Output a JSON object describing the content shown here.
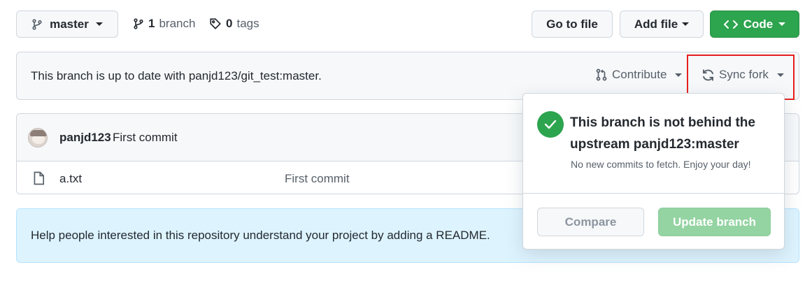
{
  "toolbar": {
    "branch_button_label": "master",
    "branch_count": "1",
    "branch_word": "branch",
    "tag_count": "0",
    "tag_word": "tags",
    "go_to_file_label": "Go to file",
    "add_file_label": "Add file",
    "code_label": "Code"
  },
  "status_bar": {
    "message": "This branch is up to date with panjd123/git_test:master.",
    "contribute_label": "Contribute",
    "sync_fork_label": "Sync fork"
  },
  "commit": {
    "author": "panjd123",
    "message": "First commit"
  },
  "files": [
    {
      "name": "a.txt",
      "commit_message": "First commit"
    }
  ],
  "readme_banner": {
    "text": "Help people interested in this repository understand your project by adding a README."
  },
  "sync_popover": {
    "title_line1": "This branch is not behind the",
    "title_line2": "upstream panjd123:master",
    "subtitle": "No new commits to fetch. Enjoy your day!",
    "compare_label": "Compare",
    "update_label": "Update branch"
  },
  "colors": {
    "primary_green": "#2da44e",
    "disabled_green": "#94d3a2",
    "highlight_red": "#e5201e",
    "banner_bg": "#ddf4ff",
    "banner_border": "#b6e3ff"
  },
  "icons": {
    "branch": "git-branch-icon",
    "tag": "tag-icon",
    "code": "code-icon",
    "contribute": "git-pull-request-icon",
    "sync": "sync-icon",
    "file": "file-icon",
    "check": "check-circle-icon"
  }
}
